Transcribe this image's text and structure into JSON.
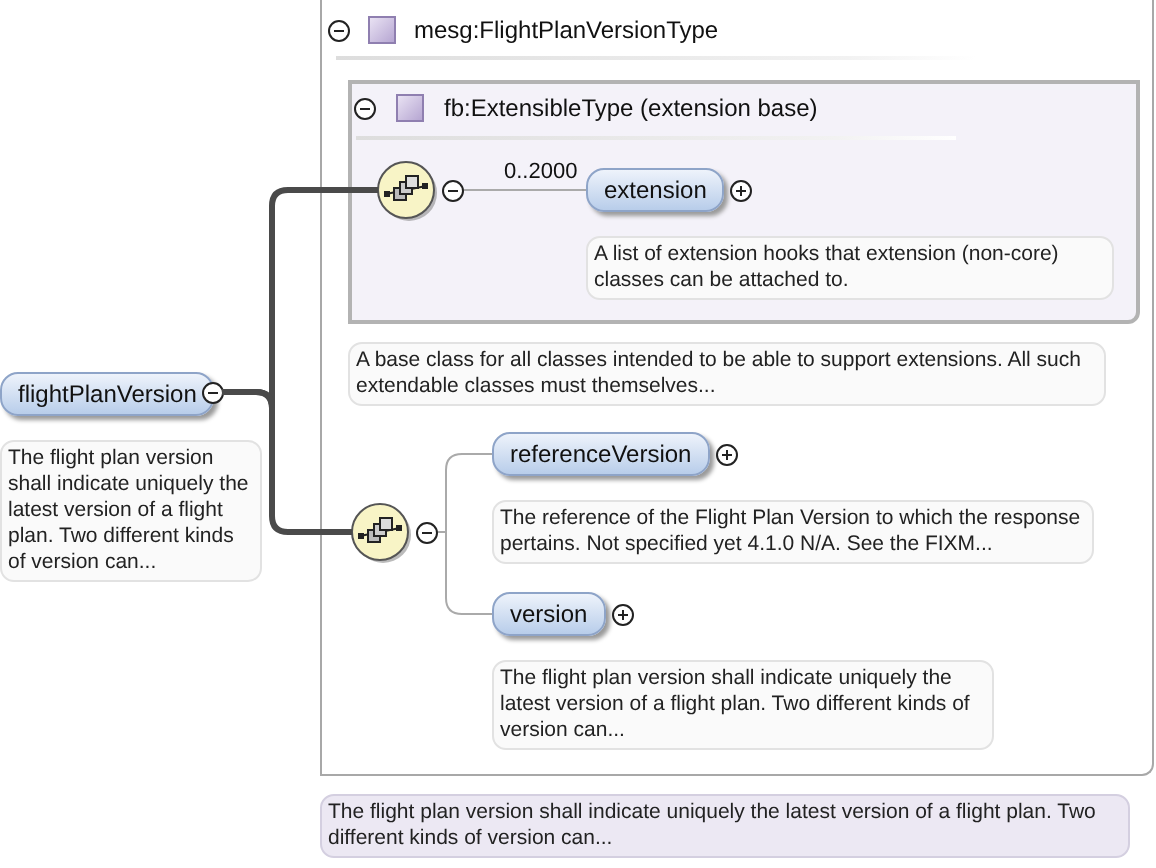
{
  "root": {
    "name": "flightPlanVersion",
    "expanded": true,
    "doc": "The flight plan version shall indicate uniquely the latest version of a flight plan. Two different kinds of version can..."
  },
  "type": {
    "title": "mesg:FlightPlanVersionType",
    "expanded": true,
    "doc": "The flight plan version shall indicate uniquely the latest version of a flight plan. Two different kinds of version can..."
  },
  "base": {
    "title": "fb:ExtensibleType (extension base)",
    "expanded": true,
    "doc": "A base class for all classes intended to be able to support extensions. All such extendable classes must themselves..."
  },
  "sequences": [
    {
      "expanded": true,
      "elements": [
        {
          "name": "extension",
          "occurs": "0..2000",
          "expanded": false,
          "doc": "A list of extension hooks that extension (non-core) classes can be attached to."
        }
      ]
    },
    {
      "expanded": true,
      "elements": [
        {
          "name": "referenceVersion",
          "expanded": false,
          "doc": "The reference of the Flight Plan Version to which the response pertains. Not specified yet 4.1.0 N/A. See the FIXM..."
        },
        {
          "name": "version",
          "expanded": false,
          "doc": "The flight plan version shall indicate uniquely the latest version of a flight plan. Two different kinds of version can..."
        }
      ]
    }
  ]
}
